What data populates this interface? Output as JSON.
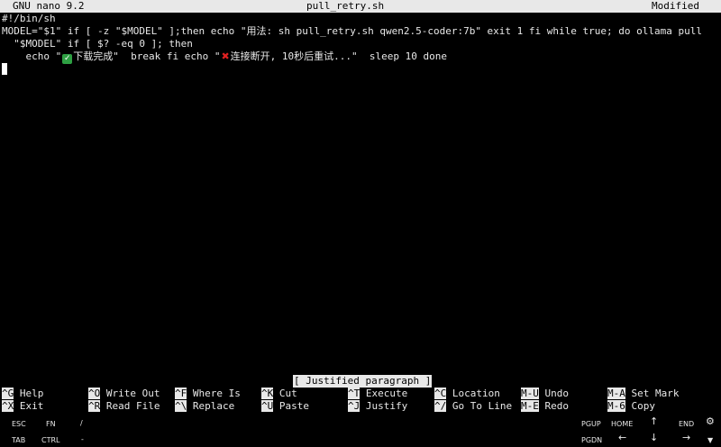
{
  "titlebar": {
    "app": "GNU nano 9.2",
    "filename": "pull_retry.sh",
    "state": "Modified"
  },
  "editor": {
    "lines": [
      "#!/bin/sh",
      "MODEL=\"$1\" if [ -z \"$MODEL\" ];then echo \"用法: sh pull_retry.sh qwen2.5-coder:7b\" exit 1 fi while true; do ollama pull",
      "  \"$MODEL\" if [ $? -eq 0 ]; then"
    ],
    "line4": {
      "prefix": "    echo \"",
      "check_emoji": "✓",
      "middle": "下载完成\"  break fi echo \"",
      "x_emoji": "✖",
      "suffix": "连接断开, 10秒后重试...\"  sleep 10 done"
    }
  },
  "status_message": "[ Justified paragraph ]",
  "shortcuts": [
    {
      "key": "^G",
      "label": "Help"
    },
    {
      "key": "^O",
      "label": "Write Out"
    },
    {
      "key": "^F",
      "label": "Where Is"
    },
    {
      "key": "^K",
      "label": "Cut"
    },
    {
      "key": "^T",
      "label": "Execute"
    },
    {
      "key": "^C",
      "label": "Location"
    },
    {
      "key": "M-U",
      "label": "Undo"
    },
    {
      "key": "M-A",
      "label": "Set Mark"
    },
    {
      "key": "^X",
      "label": "Exit"
    },
    {
      "key": "^R",
      "label": "Read File"
    },
    {
      "key": "^\\",
      "label": "Replace"
    },
    {
      "key": "^U",
      "label": "Paste"
    },
    {
      "key": "^J",
      "label": "Justify"
    },
    {
      "key": "^/",
      "label": "Go To Line"
    },
    {
      "key": "M-E",
      "label": "Redo"
    },
    {
      "key": "M-6",
      "label": "Copy"
    }
  ],
  "extra_keys": {
    "row1": {
      "esc": "ESC",
      "fn": "FN",
      "slash": "/",
      "pgup": "PGUP",
      "home": "HOME",
      "up": "↑",
      "end": "END",
      "settings": "⚙"
    },
    "row2": {
      "tab": "TAB",
      "ctrl": "CTRL",
      "minus": "-",
      "pgdn": "PGDN",
      "left": "←",
      "down": "↓",
      "right": "→",
      "menu": "▼"
    }
  }
}
